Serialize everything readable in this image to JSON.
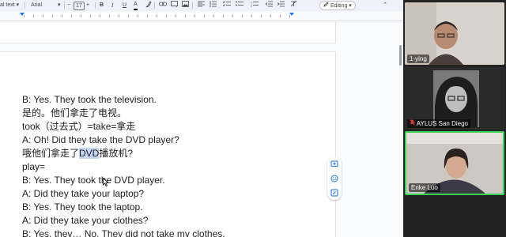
{
  "toolbar": {
    "style": "al text",
    "font": "Arial",
    "minus": "−",
    "size": "17",
    "plus": "+",
    "bold": "B",
    "italic": "I",
    "underline": "U",
    "text_color": "A",
    "mode": "Editing"
  },
  "document": {
    "lines": [
      "B: Yes. They took the television.",
      "是的。他们拿走了电视。",
      "took（过去式）=take=拿走",
      "A: Oh! Did they take the DVD player?",
      "哦他们拿走了DVD播放机?",
      "play=",
      "B: Yes. They took the DVD player.",
      "A: Did they take your laptop?",
      "B: Yes. They took the laptop.",
      "A: Did they take your clothes?",
      "B: Yes, they… No. They did not take my clothes."
    ],
    "highlight_line5": {
      "before": "哦他们拿走了",
      "selected": "DVD",
      "after": "播放机?"
    }
  },
  "participants": [
    {
      "name": "1-ying",
      "muted": false
    },
    {
      "name": "AYLUS San Diego",
      "muted": true
    },
    {
      "name": "Enke Luo",
      "muted": false,
      "active_speaker": true
    }
  ],
  "colors": {
    "active_speaker": "#39d353",
    "muted": "#e53935",
    "selection": "#c5d6f4",
    "accent": "#1a73e8"
  }
}
